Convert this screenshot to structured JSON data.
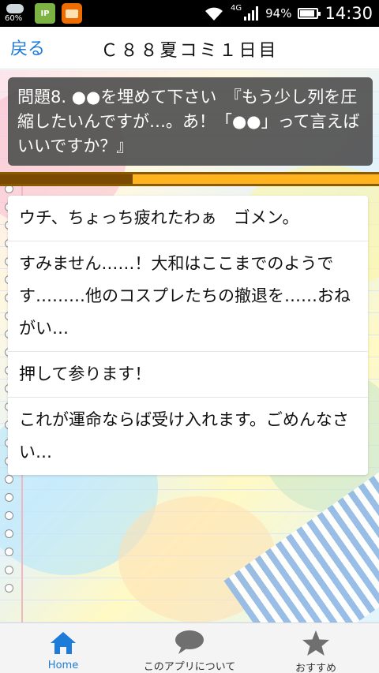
{
  "status_bar": {
    "battery_small_pct": "60%",
    "app1_label": "IP",
    "network": "4G",
    "battery_pct": "94%",
    "time": "14:30"
  },
  "header": {
    "back_label": "戻る",
    "title": "Ｃ８８夏コミ１日目"
  },
  "question": {
    "text": "問題8. ●●を埋めて下さい　『もう少し列を圧縮したいんですが…。あ！「●●」って言えばいいですか？』"
  },
  "progress": {
    "fraction": 0.35
  },
  "answers": [
    "ウチ、ちょっち疲れたわぁ　ゴメン。",
    "すみません……！大和はここまでのようです………他のコスプレたちの撤退を……おねがい…",
    "押して参ります！",
    "これが運命ならば受け入れます。ごめんなさい…"
  ],
  "bottom_nav": {
    "items": [
      {
        "label": "Home",
        "icon": "home-icon"
      },
      {
        "label": "このアプリについて",
        "icon": "speech-bubble-icon"
      },
      {
        "label": "おすすめ",
        "icon": "star-icon"
      }
    ]
  },
  "colors": {
    "accent": "#1e7bd8",
    "progress_track": "#ffb41f",
    "progress_fill": "#7a4a00"
  }
}
